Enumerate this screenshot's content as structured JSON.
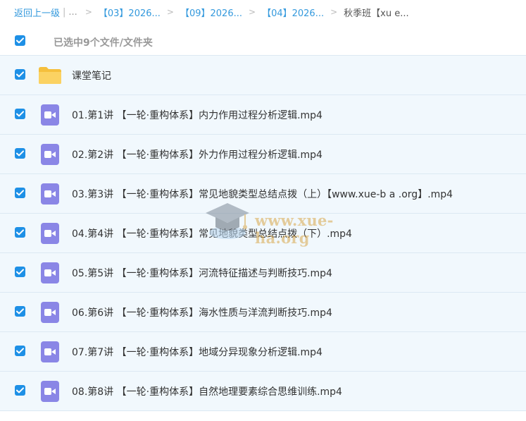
{
  "breadcrumb": {
    "back": "返回上一级",
    "separator": "|",
    "ellipsis": "...",
    "arrow": ">",
    "items": [
      "【03】2026...",
      "【09】2026...",
      "【04】2026..."
    ],
    "current": "秋季班【xu e..."
  },
  "selection": {
    "checked": true,
    "summary": "已选中9个文件/文件夹"
  },
  "files": [
    {
      "type": "folder",
      "icon": "folder-icon",
      "name": "课堂笔记",
      "checked": true
    },
    {
      "type": "video",
      "icon": "video-icon",
      "name": "01.第1讲 【一轮·重构体系】内力作用过程分析逻辑.mp4",
      "checked": true
    },
    {
      "type": "video",
      "icon": "video-icon",
      "name": "02.第2讲 【一轮·重构体系】外力作用过程分析逻辑.mp4",
      "checked": true
    },
    {
      "type": "video",
      "icon": "video-icon",
      "name": "03.第3讲 【一轮·重构体系】常见地貌类型总结点拨（上）【www.xue-b a .org】.mp4",
      "checked": true
    },
    {
      "type": "video",
      "icon": "video-icon",
      "name": "04.第4讲 【一轮·重构体系】常见地貌类型总结点拨（下）.mp4",
      "checked": true
    },
    {
      "type": "video",
      "icon": "video-icon",
      "name": "05.第5讲 【一轮·重构体系】河流特征描述与判断技巧.mp4",
      "checked": true
    },
    {
      "type": "video",
      "icon": "video-icon",
      "name": "06.第6讲 【一轮·重构体系】海水性质与洋流判断技巧.mp4",
      "checked": true
    },
    {
      "type": "video",
      "icon": "video-icon",
      "name": "07.第7讲 【一轮·重构体系】地域分异现象分析逻辑.mp4",
      "checked": true
    },
    {
      "type": "video",
      "icon": "video-icon",
      "name": "08.第8讲 【一轮·重构体系】自然地理要素综合思维训练.mp4",
      "checked": true
    }
  ],
  "watermark": {
    "text": "www.xue-ha.org"
  },
  "colors": {
    "accent": "#1e90e6",
    "link": "#3399dd",
    "row_bg": "#f1f8fd",
    "folder": "#f7c64a",
    "video": "#8a86e6"
  }
}
